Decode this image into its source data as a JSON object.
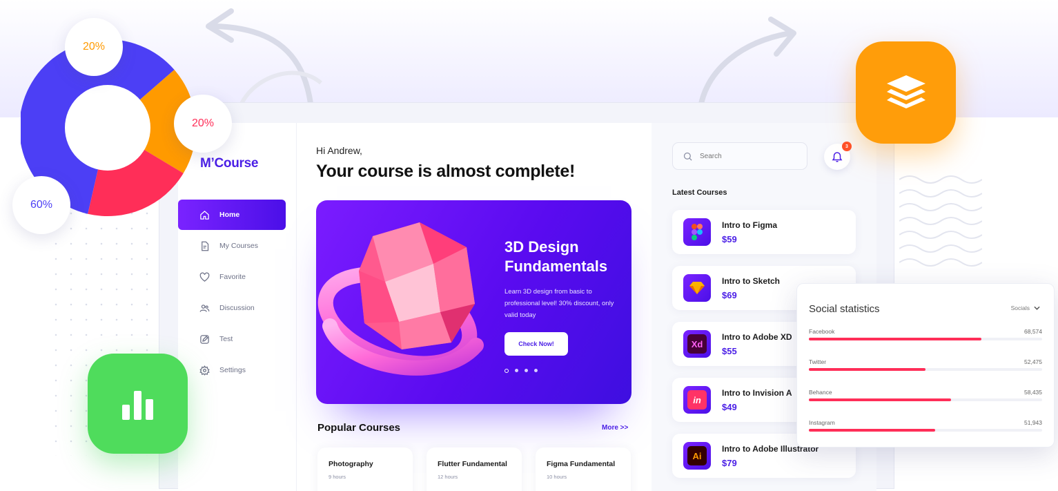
{
  "brand": "M’Course",
  "nav": [
    {
      "label": "Home",
      "icon": "home-icon",
      "active": true
    },
    {
      "label": "My Courses",
      "icon": "document-icon"
    },
    {
      "label": "Favorite",
      "icon": "heart-icon"
    },
    {
      "label": "Discussion",
      "icon": "users-icon"
    },
    {
      "label": "Test",
      "icon": "edit-icon"
    },
    {
      "label": "Settings",
      "icon": "gear-icon"
    }
  ],
  "main": {
    "greeting": "Hi Andrew,",
    "headline": "Your course is almost complete!",
    "hero": {
      "title_line1": "3D Design",
      "title_line2": "Fundamentals",
      "description": "Learn 3D design from basic to professional level! 30% discount, only valid today",
      "button": "Check Now!",
      "slides": 4,
      "active_slide": 1
    },
    "popular_title": "Popular Courses",
    "more_link": "More >>",
    "popular": [
      {
        "title": "Photography",
        "hours": "9 hours"
      },
      {
        "title": "Flutter Fundamental",
        "hours": "12 hours"
      },
      {
        "title": "Figma Fundamental",
        "hours": "10 hours"
      }
    ]
  },
  "right": {
    "search_placeholder": "Search",
    "notification_count": "3",
    "latest_title": "Latest Courses",
    "courses": [
      {
        "title": "Intro to Figma",
        "price": "$59",
        "icon": "figma-icon"
      },
      {
        "title": "Intro to Sketch",
        "price": "$69",
        "icon": "sketch-icon"
      },
      {
        "title": "Intro to Adobe XD",
        "price": "$55",
        "icon": "xd-icon",
        "badge": "Xd"
      },
      {
        "title": "Intro to Invision A",
        "price": "$49",
        "icon": "invision-icon",
        "badge": "in"
      },
      {
        "title": "Intro to Adobe Illustrator",
        "price": "$79",
        "icon": "illustrator-icon",
        "badge": "Ai"
      }
    ]
  },
  "social": {
    "title": "Social statistics",
    "filter": "Socials",
    "rows": [
      {
        "label": "Facebook",
        "value": "68,574",
        "level": 0.74
      },
      {
        "label": "Twitter",
        "value": "52,475",
        "level": 0.5
      },
      {
        "label": "Behance",
        "value": "58,435",
        "level": 0.61
      },
      {
        "label": "Instagram",
        "value": "51,943",
        "level": 0.54
      }
    ]
  },
  "donut": {
    "segments": [
      {
        "label": "60%",
        "value": 60,
        "color": "#4c3ff5"
      },
      {
        "label": "20%",
        "value": 20,
        "color": "#ff9a00"
      },
      {
        "label": "20%",
        "value": 20,
        "color": "#ff2e58"
      }
    ]
  },
  "colors": {
    "accent": "#4b1fe6",
    "hero_start": "#7b1cff",
    "hero_end": "#3e0fe0",
    "bar": "#ff2e58",
    "orange": "#ff9d0a",
    "green": "#4fdc5c"
  }
}
